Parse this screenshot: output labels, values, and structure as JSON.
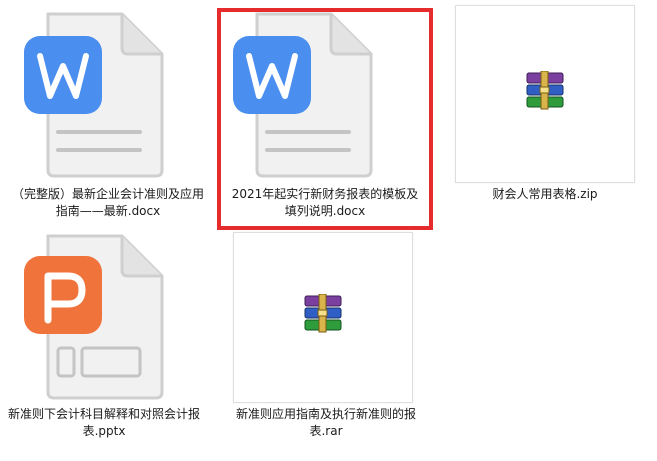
{
  "files": [
    {
      "name": "（完整版）最新企业会计准则及应用指南——最新.docx",
      "type": "docx",
      "icon": "wps-writer-icon",
      "selected": false
    },
    {
      "name": "2021年起实行新财务报表的模板及填列说明.docx",
      "type": "docx",
      "icon": "wps-writer-icon",
      "selected": true
    },
    {
      "name": "财会人常用表格.zip",
      "type": "zip",
      "icon": "winrar-archive-icon",
      "selected": false
    },
    {
      "name": "新准则下会计科目解释和对照会计报表.pptx",
      "type": "pptx",
      "icon": "wps-presentation-icon",
      "selected": false
    },
    {
      "name": "新准则应用指南及执行新准则的报表.rar",
      "type": "rar",
      "icon": "winrar-archive-icon",
      "selected": false
    }
  ],
  "colors": {
    "writer_blue": "#4a8ef0",
    "presentation_orange": "#f0733c",
    "selection_red": "#e52b2b",
    "page_gray": "#ececec",
    "page_stroke": "#c9c9c9"
  }
}
